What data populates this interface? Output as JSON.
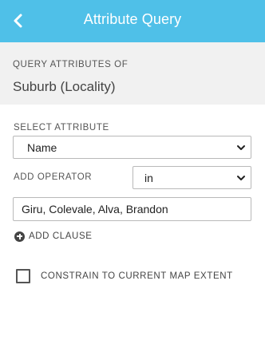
{
  "header": {
    "title": "Attribute Query",
    "back_icon": "chevron-left-icon",
    "background_color": "#4fc0e8"
  },
  "query_of": {
    "label": "QUERY ATTRIBUTES OF",
    "layer": "Suburb (Locality)"
  },
  "attribute": {
    "label": "SELECT ATTRIBUTE",
    "selected": "Name"
  },
  "operator": {
    "label": "ADD OPERATOR",
    "selected": "in"
  },
  "value_input": {
    "value": "Giru, Colevale, Alva, Brandon"
  },
  "add_clause": {
    "label": "ADD CLAUSE",
    "icon": "plus-circle-icon"
  },
  "constrain": {
    "label": "CONSTRAIN TO CURRENT MAP EXTENT",
    "checked": false
  }
}
